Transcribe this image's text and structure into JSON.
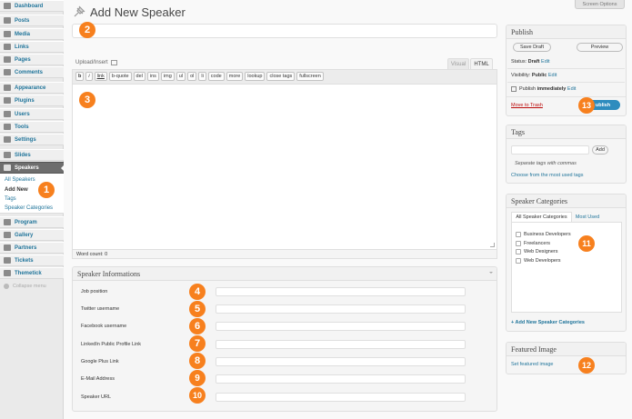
{
  "sidebar": {
    "items": [
      {
        "label": "Dashboard",
        "icon": "dashboard-icon"
      },
      {
        "label": "Posts",
        "icon": "pushpin-icon"
      },
      {
        "label": "Media",
        "icon": "media-icon"
      },
      {
        "label": "Links",
        "icon": "link-icon"
      },
      {
        "label": "Pages",
        "icon": "page-icon"
      },
      {
        "label": "Comments",
        "icon": "comment-icon"
      },
      {
        "label": "Appearance",
        "icon": "paintbrush-icon"
      },
      {
        "label": "Plugins",
        "icon": "plug-icon"
      },
      {
        "label": "Users",
        "icon": "users-icon"
      },
      {
        "label": "Tools",
        "icon": "wrench-icon"
      },
      {
        "label": "Settings",
        "icon": "settings-icon"
      },
      {
        "label": "Slides",
        "icon": "slides-icon"
      },
      {
        "label": "Speakers",
        "icon": "speakers-icon"
      },
      {
        "label": "Program",
        "icon": "program-icon"
      },
      {
        "label": "Gallery",
        "icon": "gallery-icon"
      },
      {
        "label": "Partners",
        "icon": "partners-icon"
      },
      {
        "label": "Tickets",
        "icon": "tickets-icon"
      },
      {
        "label": "Themetick",
        "icon": "themetick-icon"
      }
    ],
    "submenu": [
      "All Speakers",
      "Add New",
      "Tags",
      "Speaker Categories"
    ],
    "collapse": "Collapse menu"
  },
  "screen_options": "Screen Options",
  "page_title": "Add New Speaker",
  "editor": {
    "upload_insert": "Upload/Insert",
    "tabs": [
      "Visual",
      "HTML"
    ],
    "buttons": [
      "b",
      "i",
      "link",
      "b-quote",
      "del",
      "ins",
      "img",
      "ul",
      "ol",
      "li",
      "code",
      "more",
      "lookup",
      "close tags",
      "fullscreen"
    ],
    "word_count": "Word count: 0"
  },
  "speaker_info": {
    "title": "Speaker Informations",
    "fields": [
      "Job position",
      "Twitter username",
      "Facebook username",
      "LinkedIn Public Profile Link",
      "Google Plus Link",
      "E-Mail Address",
      "Speaker URL"
    ]
  },
  "publish": {
    "title": "Publish",
    "save_draft": "Save Draft",
    "preview": "Preview",
    "status_label": "Status:",
    "status_value": "Draft",
    "edit": "Edit",
    "visibility_label": "Visibility:",
    "visibility_value": "Public",
    "publish_label": "Publish",
    "publish_value": "immediately",
    "move_to_trash": "Move to Trash",
    "publish_button": "ublish"
  },
  "tags": {
    "title": "Tags",
    "add": "Add",
    "hint": "Separate tags with commas",
    "choose": "Choose from the most used tags"
  },
  "categories": {
    "title": "Speaker Categories",
    "tabs": [
      "All Speaker Categories",
      "Most Used"
    ],
    "items": [
      "Business Developers",
      "Freelancers",
      "Web Designers",
      "Web Developers"
    ],
    "add_new": "+ Add New Speaker Categories"
  },
  "featured": {
    "title": "Featured Image",
    "link": "Set featured image"
  },
  "badges": [
    "1",
    "2",
    "3",
    "4",
    "5",
    "6",
    "7",
    "8",
    "9",
    "10",
    "11",
    "12",
    "13"
  ],
  "colors": {
    "badge": "#f7801e",
    "link": "#21759b",
    "publish_button": "#2e8cbe",
    "active_menu": "#6d6d6d"
  }
}
